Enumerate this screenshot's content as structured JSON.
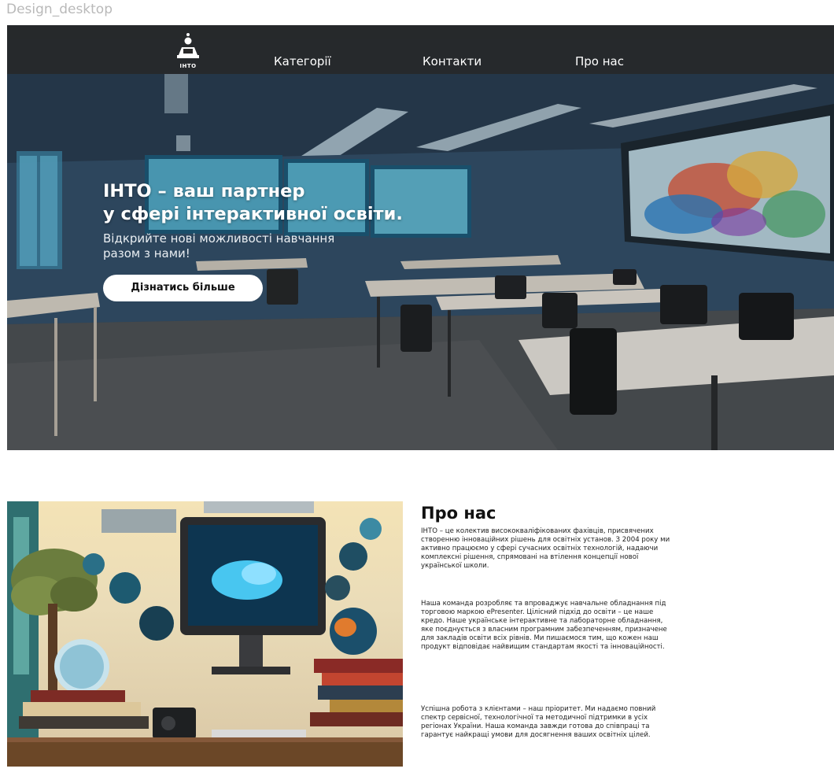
{
  "frame_label": "Design_desktop",
  "nav": {
    "logo_text": "ІНТО",
    "items": [
      "Категорії",
      "Контакти",
      "Про нас"
    ]
  },
  "hero": {
    "title_line1": "ІНТО – ваш партнер",
    "title_line2": "у сфері інтерактивної освіти.",
    "subtitle_line1": "Відкрийте нові можливості навчання",
    "subtitle_line2": "разом з нами!",
    "button_label": "Дізнатись більше"
  },
  "about": {
    "title": "Про нас",
    "paragraphs": [
      "ІНТО – це колектив висококваліфікованих фахівців, присвячених створенню інноваційних рішень для освітніх установ. З 2004 року ми активно працюємо у сфері сучасних освітніх технологій, надаючи комплексні рішення, спрямовані на втілення концепції нової української школи.",
      "Наша команда розробляє та впроваджує навчальне обладнання під торговою маркою ePresenter. Цілісний підхід до освіти – це наше кредо. Наше українське інтерактивне та лабораторне обладнання, яке поєднується з власним програмним забезпеченням, призначене для закладів освіти всіх рівнів. Ми пишаємося тим, що кожен наш продукт відповідає найвищим стандартам якості та інноваційності.",
      "Успішна робота з клієнтами – наш пріоритет. Ми надаємо повний спектр сервісної, технологічної та методичної підтримки в усіх регіонах України. Наша команда завжди готова до співпраці та гарантує найкращі умови для досягнення ваших освітніх цілей."
    ]
  },
  "colors": {
    "nav_bg": "#2a2a2a",
    "button_bg": "#ffffff",
    "text_dark": "#111111"
  }
}
